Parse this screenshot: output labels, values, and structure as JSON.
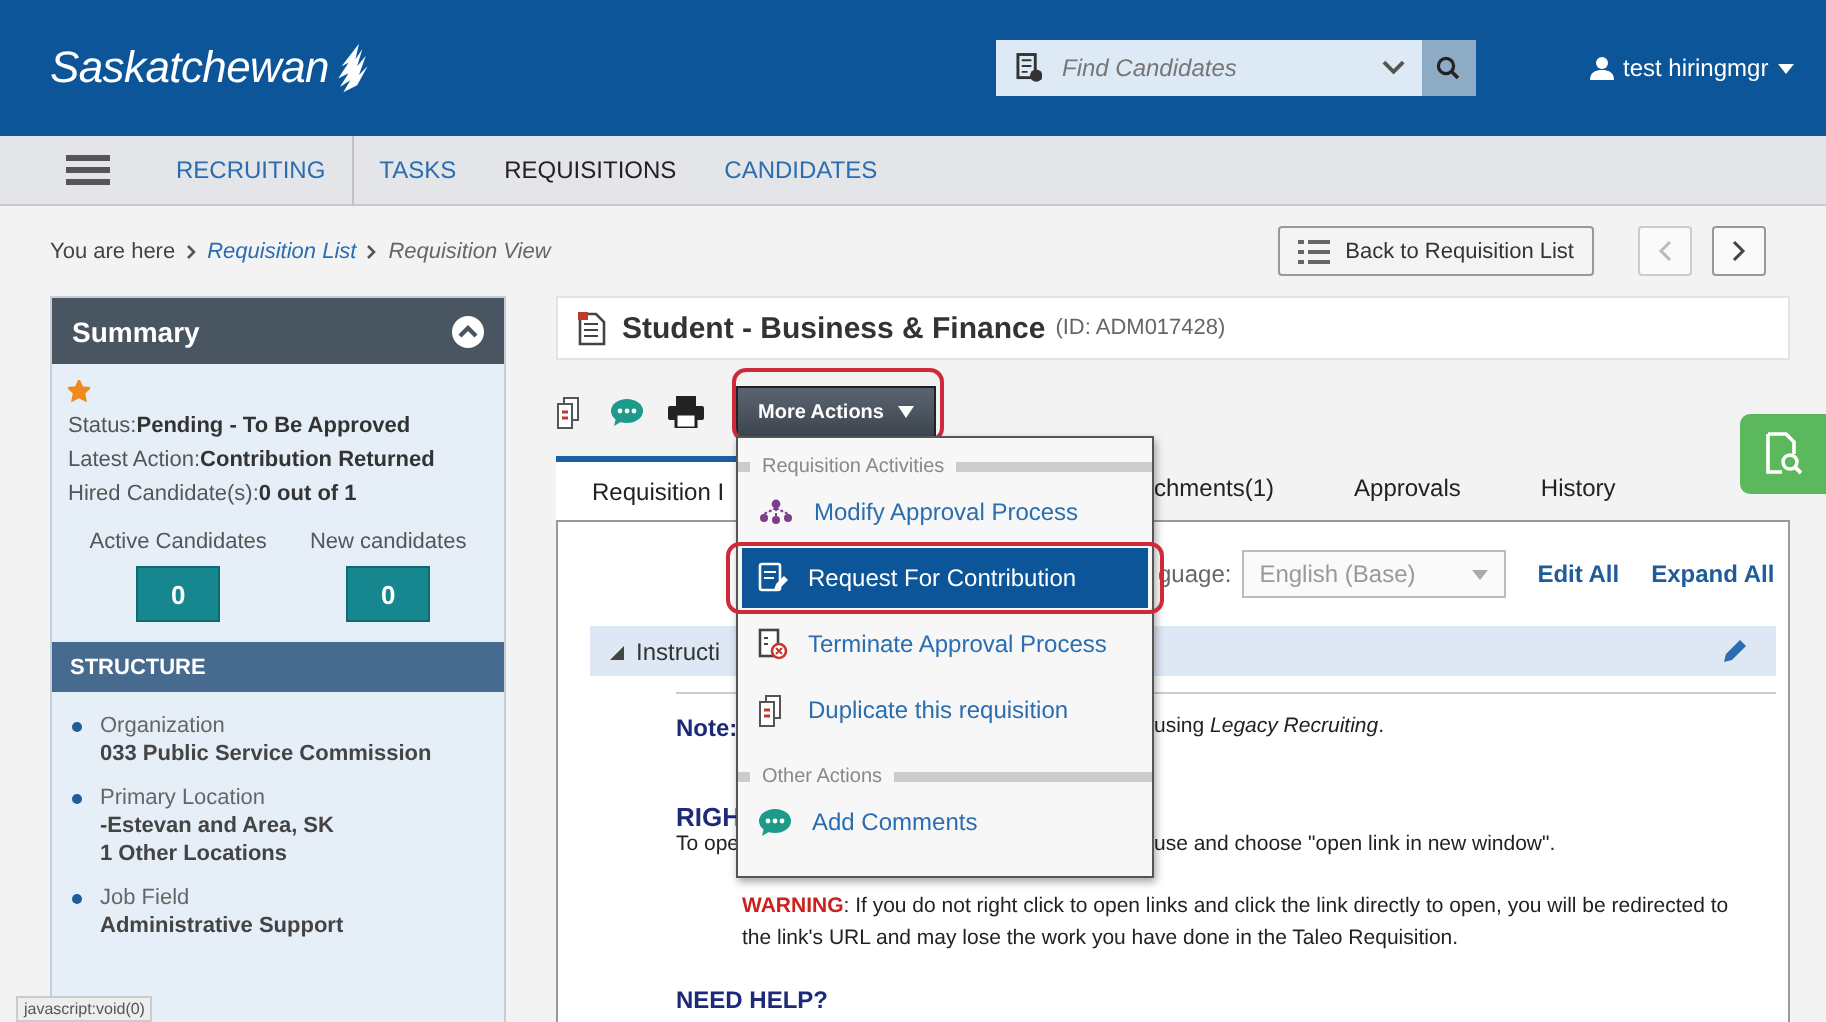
{
  "header": {
    "logo": "Saskatchewan",
    "search": {
      "placeholder": "Find Candidates"
    },
    "user": "test hiringmgr"
  },
  "nav": {
    "items": [
      {
        "label": "RECRUITING",
        "selected": false
      },
      {
        "label": "TASKS",
        "selected": false
      },
      {
        "label": "REQUISITIONS",
        "selected": true
      },
      {
        "label": "CANDIDATES",
        "selected": false
      }
    ]
  },
  "breadcrumb": {
    "prefix": "You are here",
    "items": [
      {
        "label": "Requisition List",
        "kind": "link"
      },
      {
        "label": "Requisition View",
        "kind": "current"
      }
    ]
  },
  "back_button": "Back to Requisition List",
  "summary": {
    "title": "Summary",
    "starred": true,
    "lines": [
      {
        "label": "Status:",
        "value": "Pending - To Be Approved"
      },
      {
        "label": "Latest Action:",
        "value": "Contribution Returned"
      },
      {
        "label": "Hired Candidate(s):",
        "value": "0 out of 1"
      }
    ],
    "counters": [
      {
        "label": "Active Candidates",
        "value": "0"
      },
      {
        "label": "New candidates",
        "value": "0"
      }
    ],
    "structure_title": "STRUCTURE",
    "structure": [
      {
        "label": "Organization",
        "values": [
          "033 Public Service Commission"
        ]
      },
      {
        "label": "Primary Location",
        "values": [
          "-Estevan and Area, SK",
          "1 Other Locations"
        ]
      },
      {
        "label": "Job Field",
        "values": [
          "Administrative Support"
        ]
      }
    ]
  },
  "requisition": {
    "title": "Student - Business & Finance",
    "id": "(ID: ADM017428)",
    "more_actions": {
      "label": "More Actions",
      "annotated": true
    }
  },
  "menu": {
    "sections": [
      {
        "heading": "Requisition Activities",
        "items": [
          {
            "label": "Modify Approval Process",
            "kind": "approval",
            "selected": false,
            "annotated": false
          },
          {
            "label": "Request For Contribution",
            "kind": "contribution",
            "selected": true,
            "annotated": true
          },
          {
            "label": "Terminate Approval Process",
            "kind": "terminate",
            "selected": false,
            "annotated": false
          },
          {
            "label": "Duplicate this requisition",
            "kind": "duplicate",
            "selected": false,
            "annotated": false
          }
        ]
      },
      {
        "heading": "Other Actions",
        "items": [
          {
            "label": "Add Comments",
            "kind": "comment",
            "selected": false,
            "annotated": false
          }
        ]
      }
    ]
  },
  "tabs": [
    {
      "label": "Requisition I",
      "selected": true
    },
    {
      "label": "chments(1)",
      "selected": false
    },
    {
      "label": "Approvals",
      "selected": false
    },
    {
      "label": "History",
      "selected": false
    }
  ],
  "language": {
    "label": "guage:",
    "value": "English (Base)",
    "disabled": true
  },
  "links": [
    "Edit All",
    "Expand All"
  ],
  "section": {
    "title": "Instructi",
    "expanded": true
  },
  "body": {
    "note_label": "Note:",
    "note_rest": "using *Legacy Recruiting*.",
    "heading": "RIGH",
    "line_start": "To ope",
    "line_rest": "use and choose \"open link in new window\".",
    "warning_label": "WARNING",
    "warning_text": ": If you do not right click to open links and click the link directly to open, you will be redirected to the link's URL and may lose the work you have done in the Taleo Requisition.",
    "help": "NEED HELP?"
  },
  "status_bar": "javascript:void(0)"
}
